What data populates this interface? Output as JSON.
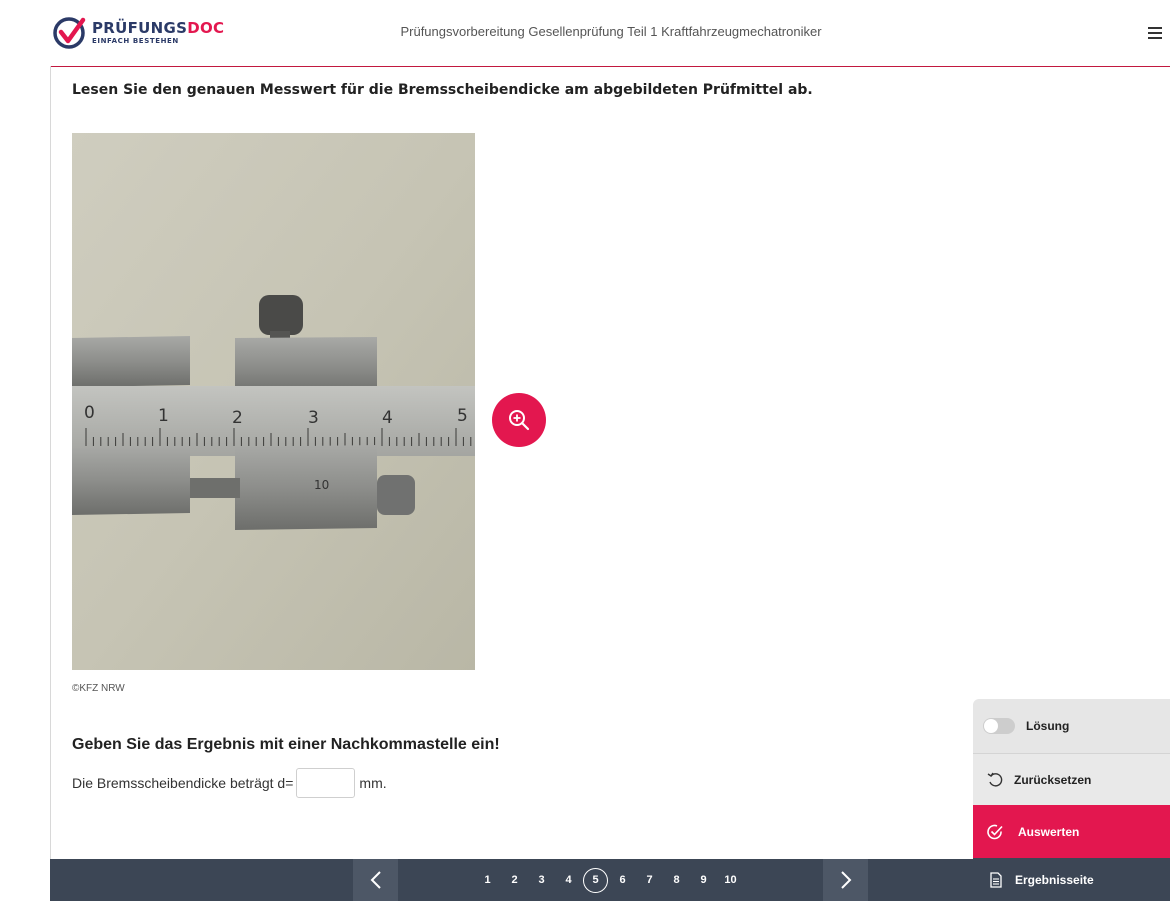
{
  "header": {
    "logo_main_part1": "PRÜFUNGS",
    "logo_main_part2": "DOC",
    "logo_sub": "EINFACH BESTEHEN",
    "title": "Prüfungsvorbereitung Gesellenprüfung Teil 1 Kraftfahrzeugmechatroniker"
  },
  "question": {
    "text": "Lesen Sie den genauen Messwert für die Bremsscheibendicke am abgebildeten Prüfmittel ab.",
    "image_credit": "©KFZ NRW",
    "scale_labels": [
      "0",
      "1",
      "2",
      "3",
      "4",
      "5"
    ],
    "vernier_label": "10",
    "instruction": "Geben Sie das Ergebnis mit einer Nachkommastelle ein!",
    "answer_prefix": "Die Bremsscheibendicke beträgt d=",
    "answer_value": "",
    "answer_unit": "mm."
  },
  "side_panel": {
    "solution_label": "Lösung",
    "solution_enabled": false,
    "reset_label": "Zurücksetzen",
    "evaluate_label": "Auswerten",
    "results_label": "Ergebnisseite"
  },
  "pagination": {
    "pages": [
      "1",
      "2",
      "3",
      "4",
      "5",
      "6",
      "7",
      "8",
      "9",
      "10"
    ],
    "current_page": "5"
  },
  "colors": {
    "accent": "#e3174f",
    "nav_bg": "#3c4655",
    "brand_dark": "#2b3a67"
  },
  "icons": {
    "zoom": "zoom-in-icon",
    "menu": "hamburger-menu-icon",
    "reset": "undo-icon",
    "evaluate": "check-circle-icon",
    "results": "document-icon",
    "prev": "chevron-left-icon",
    "next": "chevron-right-icon"
  }
}
